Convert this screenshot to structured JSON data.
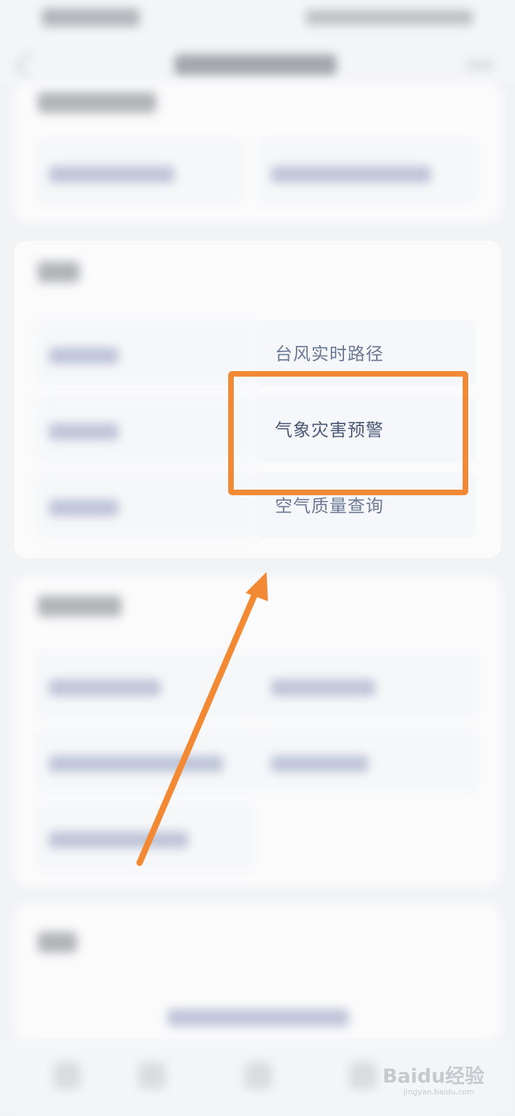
{
  "tiles_visible": {
    "typhoon": "台风实时路径",
    "weather_warning": "气象灾害预警",
    "air_quality": "空气质量查询"
  },
  "watermark": {
    "brand": "Baidu经验",
    "url": "jingyan.baidu.com"
  },
  "annotation": {
    "color": "#f28a35",
    "target": "weather_warning"
  }
}
